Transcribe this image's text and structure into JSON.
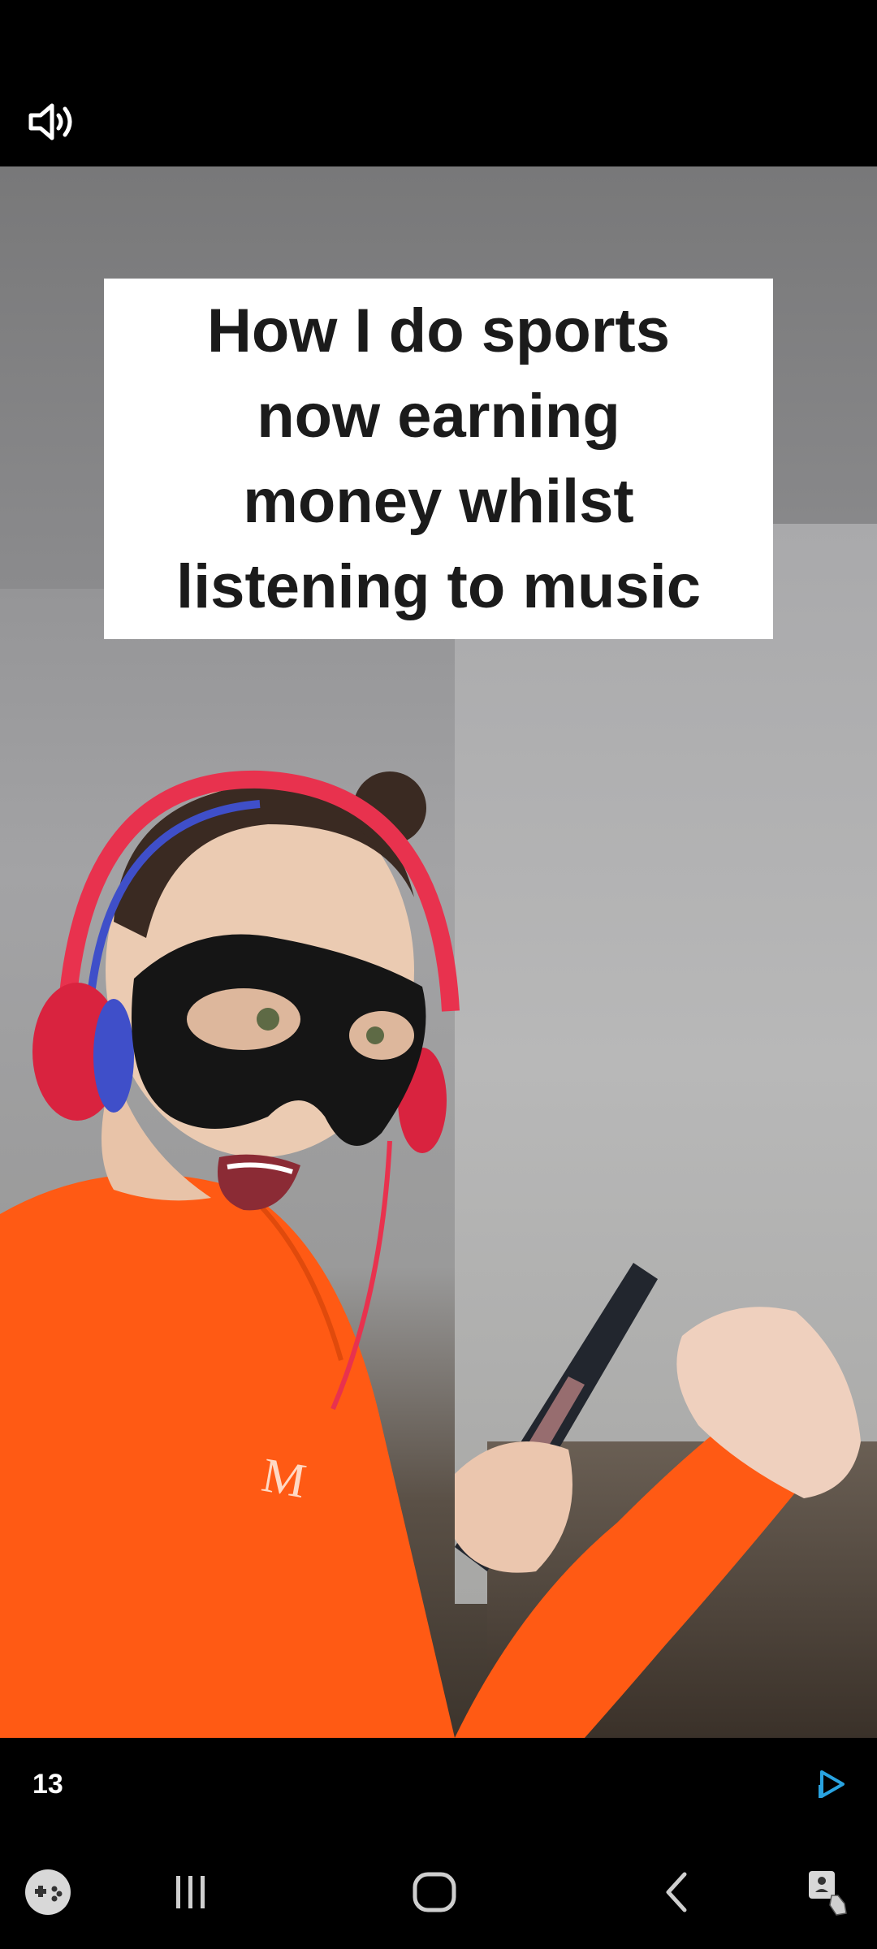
{
  "caption": {
    "line1": "How I do sports",
    "line2": "now earning",
    "line3": "money whilst",
    "line4": "listening to music"
  },
  "footer": {
    "count": "13"
  },
  "colors": {
    "accent": "#29A3E0",
    "sweater": "#FF5A14",
    "headphones": "#E8324E"
  },
  "icons": {
    "sound": "speaker-icon",
    "share": "play-share-icon",
    "game": "gamepad-icon",
    "recents": "recents-icon",
    "home": "home-icon",
    "back": "back-icon",
    "assist": "accessibility-icon"
  }
}
